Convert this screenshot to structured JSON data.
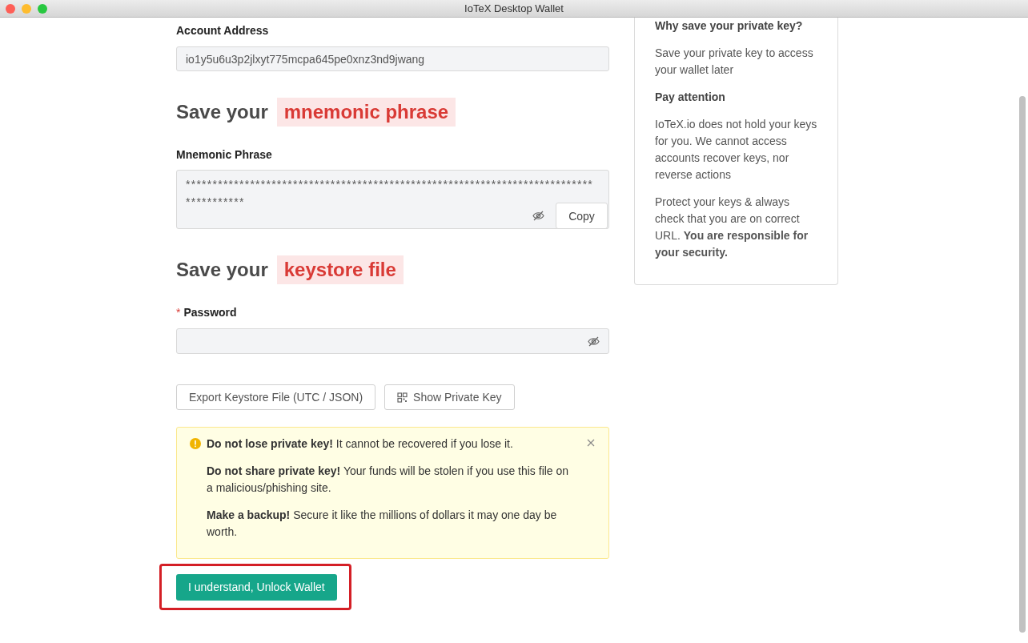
{
  "window": {
    "title": "IoTeX Desktop Wallet"
  },
  "account": {
    "label": "Account Address",
    "value": "io1y5u6u3p2jlxyt775mcpa645pe0xnz3nd9jwang"
  },
  "mnemonic_section": {
    "heading": "Save your",
    "highlight": "mnemonic phrase"
  },
  "mnemonic": {
    "label": "Mnemonic Phrase",
    "value": "***************************************************************************************",
    "copy_button": "Copy"
  },
  "keystore_section": {
    "heading": "Save your",
    "highlight": "keystore file"
  },
  "password": {
    "required_mark": "*",
    "label": "Password"
  },
  "buttons": [
    {
      "kind": "plain",
      "label": "Export Keystore File (UTC / JSON)"
    },
    {
      "kind": "qr",
      "label": "Show Private Key"
    }
  ],
  "alert": {
    "paragraphs": [
      "**Do not lose private key!** It cannot be recovered if you lose it.",
      "**Do not share private key!** Your funds will be stolen if you use this file on a malicious/phishing site.",
      "**Make a backup!** Secure it like the millions of dollars it may one day be worth."
    ]
  },
  "primary_button": "I understand, Unlock Wallet",
  "sidebar": {
    "blocks": [
      {
        "kind": "heading",
        "text": "Why save your private key?"
      },
      {
        "kind": "text",
        "text": "Save your private key to access your wallet later"
      },
      {
        "kind": "heading",
        "text": "Pay attention"
      },
      {
        "kind": "text",
        "text": "IoTeX.io does not hold your keys for you. We cannot access accounts recover keys, nor reverse actions"
      },
      {
        "kind": "text",
        "text": "Protect your keys & always check that you are on correct URL. **You are responsible for your security.**"
      }
    ]
  }
}
